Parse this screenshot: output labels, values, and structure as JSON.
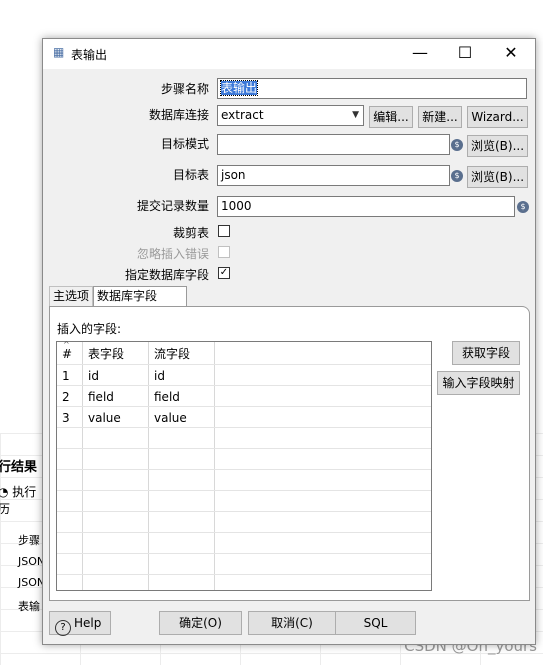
{
  "background": {
    "panel_title": "行结果",
    "panel_subtitle": "执行历",
    "rows": [
      "步骤",
      "JSON",
      "JSON",
      "表输"
    ],
    "watermark": "CSDN @Oh_yours"
  },
  "dialog": {
    "title": "表输出",
    "fields": {
      "step_name": {
        "label": "步骤名称",
        "value": "表输出"
      },
      "db_connection": {
        "label": "数据库连接",
        "value": "extract"
      },
      "target_schema": {
        "label": "目标模式",
        "value": ""
      },
      "target_table": {
        "label": "目标表",
        "value": "json"
      },
      "commit_size": {
        "label": "提交记录数量",
        "value": "1000"
      },
      "truncate_table": {
        "label": "裁剪表",
        "checked": false
      },
      "ignore_insert_errors": {
        "label": "忽略插入错误",
        "checked": false,
        "disabled": true
      },
      "specify_db_fields": {
        "label": "指定数据库字段",
        "checked": true
      }
    },
    "buttons": {
      "edit": "编辑...",
      "new": "新建...",
      "wizard": "Wizard...",
      "browse_schema": "浏览(B)...",
      "browse_table": "浏览(B)...",
      "get_fields": "获取字段",
      "enter_mapping": "输入字段映射",
      "help": "Help",
      "ok": "确定(O)",
      "cancel": "取消(C)",
      "sql": "SQL"
    },
    "tabs": [
      {
        "label": "主选项",
        "active": false
      },
      {
        "label": "数据库字段",
        "active": true
      }
    ],
    "fields_section_label": "插入的字段:",
    "table": {
      "columns": [
        "#",
        "表字段",
        "流字段"
      ],
      "rows": [
        [
          "1",
          "id",
          "id"
        ],
        [
          "2",
          "field",
          "field"
        ],
        [
          "3",
          "value",
          "value"
        ]
      ]
    }
  }
}
